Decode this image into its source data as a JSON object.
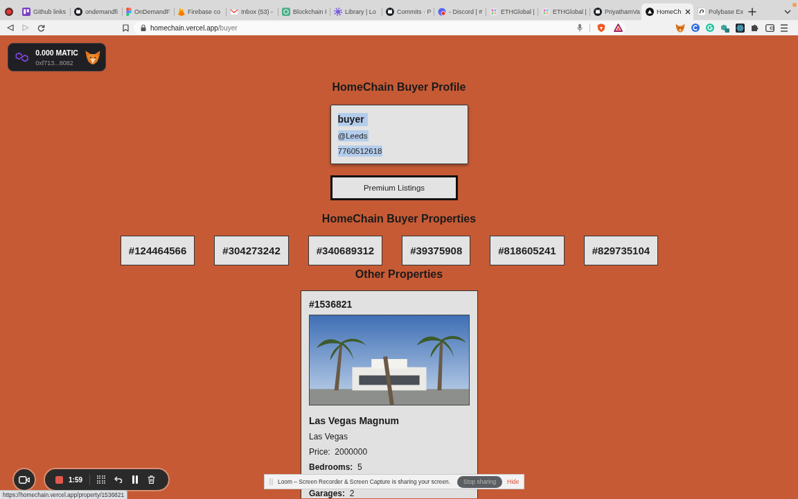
{
  "browser": {
    "tabs": [
      {
        "title": "Github links",
        "selected": false
      },
      {
        "title": "ondemandfi",
        "selected": false
      },
      {
        "title": "OnDemandF",
        "selected": false
      },
      {
        "title": "Firebase co",
        "selected": false
      },
      {
        "title": "Inbox (53) -",
        "selected": false
      },
      {
        "title": "Blockchain I",
        "selected": false
      },
      {
        "title": "Library | Lo",
        "selected": false
      },
      {
        "title": "Commits · P",
        "selected": false
      },
      {
        "title": "- Discord | #",
        "selected": false
      },
      {
        "title": "ETHGlobal |",
        "selected": false
      },
      {
        "title": "ETHGlobal |",
        "selected": false
      },
      {
        "title": "PriyathamVa",
        "selected": false
      },
      {
        "title": "HomeCh",
        "selected": true
      },
      {
        "title": "Polybase Ex",
        "selected": false
      }
    ],
    "forward_disabled": true,
    "address": {
      "host": "homechain.vercel.app",
      "path": "/buyer"
    }
  },
  "wallet": {
    "balance": "0.000 MATIC",
    "address": "0xf713...8082"
  },
  "profile": {
    "title": "HomeChain Buyer Profile",
    "lines": [
      {
        "kind": "name",
        "text": "buyer",
        "highlighted": true
      },
      {
        "kind": "handle",
        "text": "@Leeds",
        "highlighted": true
      },
      {
        "kind": "phone",
        "text": "7760512618",
        "highlighted": true
      }
    ]
  },
  "premium_button": {
    "label": "Premium Listings"
  },
  "buyer_properties": {
    "title": "HomeChain Buyer Properties",
    "ids": [
      "#124464566",
      "#304273242",
      "#340689312",
      "#39375908",
      "#818605241",
      "#829735104"
    ]
  },
  "other_properties": {
    "title": "Other Properties",
    "cards": [
      {
        "id": "#1536821",
        "name": "Las Vegas Magnum",
        "city": "Las Vegas",
        "details": [
          "Price:  2000000",
          "**Bedrooms:**  5",
          "**Garages:**  2"
        ]
      }
    ]
  },
  "recorder": {
    "timer": "1:59"
  },
  "status_url": "https://homechain.vercel.app/property/1536821",
  "share_bar": {
    "message": "Loom – Screen Recorder & Screen Capture is sharing your screen.",
    "stop_button": "Stop sharing",
    "hide_link": "Hide"
  }
}
